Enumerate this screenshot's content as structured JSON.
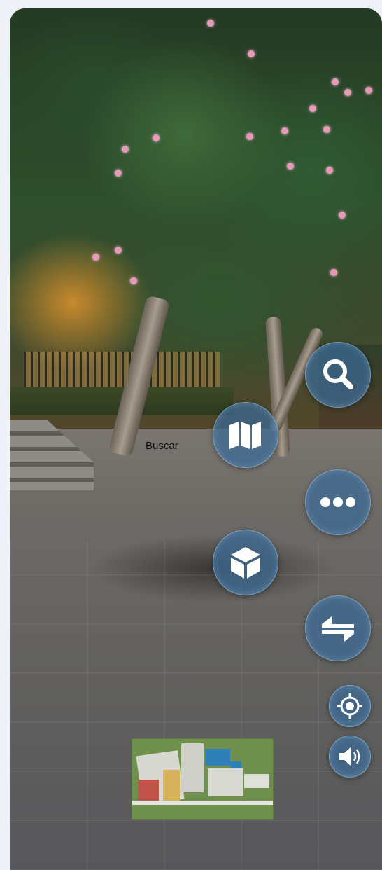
{
  "scene": {
    "description_hidden": ""
  },
  "controls": {
    "search": {
      "icon": "search-icon"
    },
    "map": {
      "icon": "map-icon",
      "label": "Buscar"
    },
    "more": {
      "icon": "more-dots-icon"
    },
    "cube": {
      "icon": "cube-3d-icon"
    },
    "swap": {
      "icon": "swap-arrows-icon"
    },
    "locate": {
      "icon": "crosshair-icon"
    },
    "audio": {
      "icon": "speaker-icon"
    }
  },
  "minimap": {
    "icon": "campus-map-thumbnail"
  },
  "colors": {
    "fab_fill": "#3a6996",
    "fab_icon": "#ffffff",
    "minimap_green": "#6f8f4c"
  }
}
